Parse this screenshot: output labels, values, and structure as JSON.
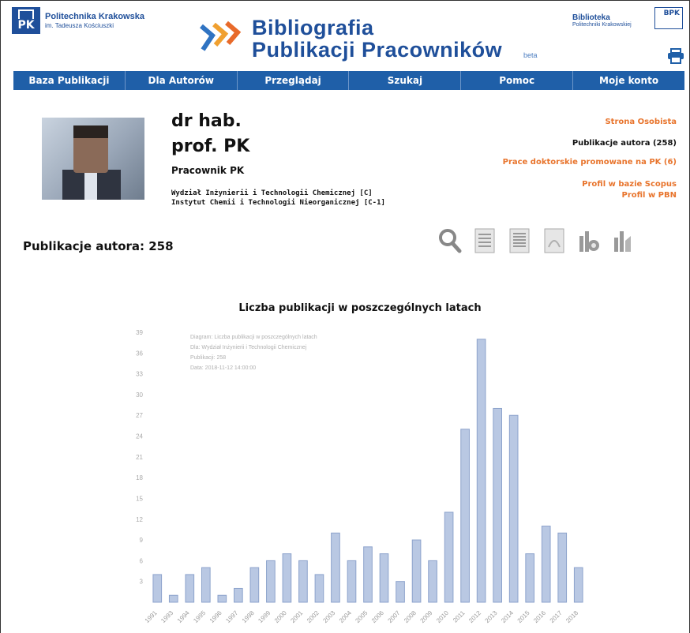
{
  "header": {
    "university_line1": "Politechnika Krakowska",
    "university_line2": "im. Tadeusza Kościuszki",
    "pk_logo_text": "PK",
    "title_line1": "Bibliografia",
    "title_line2": "Publikacji Pracowników",
    "beta": "beta",
    "library_line1": "Biblioteka",
    "library_line2": "Politechniki Krakowskiej",
    "bpk_logo_text": "BPK",
    "print_icon": "printer-icon"
  },
  "nav": {
    "items": [
      "Baza Publikacji",
      "Dla Autorów",
      "Przeglądaj",
      "Szukaj",
      "Pomoc",
      "Moje konto"
    ]
  },
  "profile": {
    "name_line1": "dr hab.",
    "name_line2": "prof. PK",
    "role": "Pracownik PK",
    "dept1": "Wydział Inżynierii i Technologii Chemicznej [C]",
    "dept2": "Instytut Chemii i Technologii Nieorganicznej [C-1]"
  },
  "side_links": {
    "personal_page": "Strona Osobista",
    "author_pubs": "Publikacje autora (258)",
    "phd_theses": "Prace doktorskie promowane na PK (6)",
    "scopus": "Profil w bazie Scopus",
    "pbn": "Profil w PBN"
  },
  "publications": {
    "count_label": "Publikacje autora: 258"
  },
  "tools": [
    "search-icon",
    "list-icon",
    "list-detail-icon",
    "pdf-icon",
    "stats-icon",
    "chart-icon"
  ],
  "chart_data": {
    "type": "bar",
    "title": "Liczba publikacji w poszczególnych latach",
    "meta_lines": [
      "Diagram: Liczba publikacji w poszczególnych latach",
      "Dla: Wydział Inżynierii i Technologii Chemicznej",
      "Publikacji: 258",
      "Data: 2018-11-12 14:00:00"
    ],
    "categories": [
      "1991",
      "1993",
      "1994",
      "1995",
      "1996",
      "1997",
      "1998",
      "1999",
      "2000",
      "2001",
      "2002",
      "2003",
      "2004",
      "2005",
      "2006",
      "2007",
      "2008",
      "2009",
      "2010",
      "2011",
      "2012",
      "2013",
      "2014",
      "2015",
      "2016",
      "2017",
      "2018"
    ],
    "values": [
      4,
      1,
      4,
      5,
      1,
      2,
      5,
      6,
      7,
      6,
      4,
      10,
      6,
      8,
      7,
      3,
      9,
      6,
      13,
      25,
      38,
      28,
      27,
      7,
      11,
      10,
      5
    ],
    "yticks": [
      3,
      6,
      9,
      12,
      15,
      18,
      21,
      24,
      27,
      30,
      33,
      36,
      39
    ],
    "ylim": [
      0,
      39
    ],
    "bar_color": "#b9c8e3",
    "bar_border": "#8da3cc"
  }
}
